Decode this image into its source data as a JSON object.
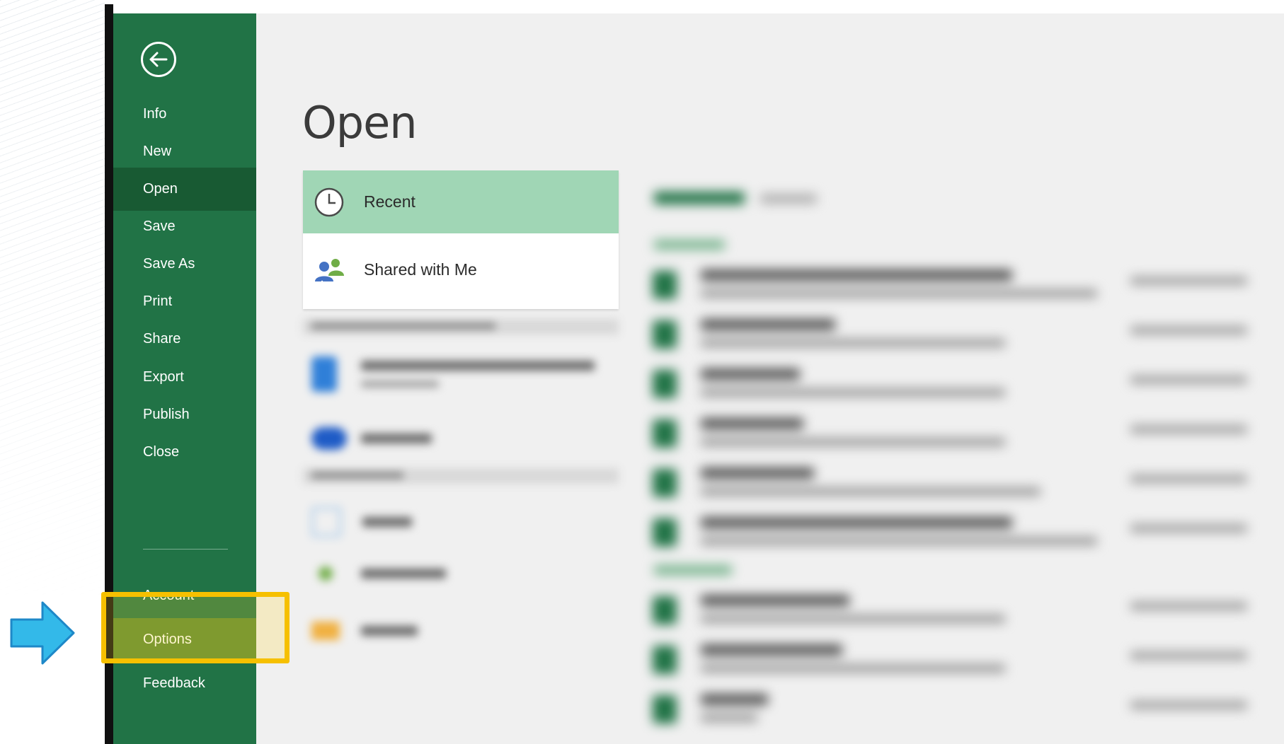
{
  "sidebar": {
    "items": [
      {
        "label": "Info"
      },
      {
        "label": "New"
      },
      {
        "label": "Open"
      },
      {
        "label": "Save"
      },
      {
        "label": "Save As"
      },
      {
        "label": "Print"
      },
      {
        "label": "Share"
      },
      {
        "label": "Export"
      },
      {
        "label": "Publish"
      },
      {
        "label": "Close"
      },
      {
        "label": "Account"
      },
      {
        "label": "Options"
      },
      {
        "label": "Feedback"
      }
    ],
    "active": "Open",
    "highlighted": "Options"
  },
  "main": {
    "title": "Open",
    "locations": [
      {
        "label": "Recent",
        "icon": "clock-icon"
      },
      {
        "label": "Shared with Me",
        "icon": "people-icon"
      }
    ]
  },
  "colors": {
    "sidebar": "#217346",
    "sidebar_active": "#185a33",
    "recent_selected": "#a0d6b5",
    "highlight_border": "#f6c000",
    "arrow": "#33b9e9"
  },
  "icons": {
    "back": "back-arrow-icon",
    "pointer": "pointer-arrow-icon"
  }
}
